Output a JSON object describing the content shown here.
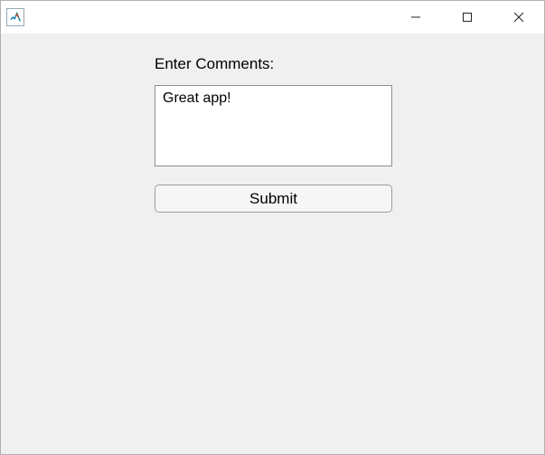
{
  "main": {
    "label": "Enter Comments:",
    "textarea_value": "Great app!",
    "submit_label": "Submit"
  }
}
